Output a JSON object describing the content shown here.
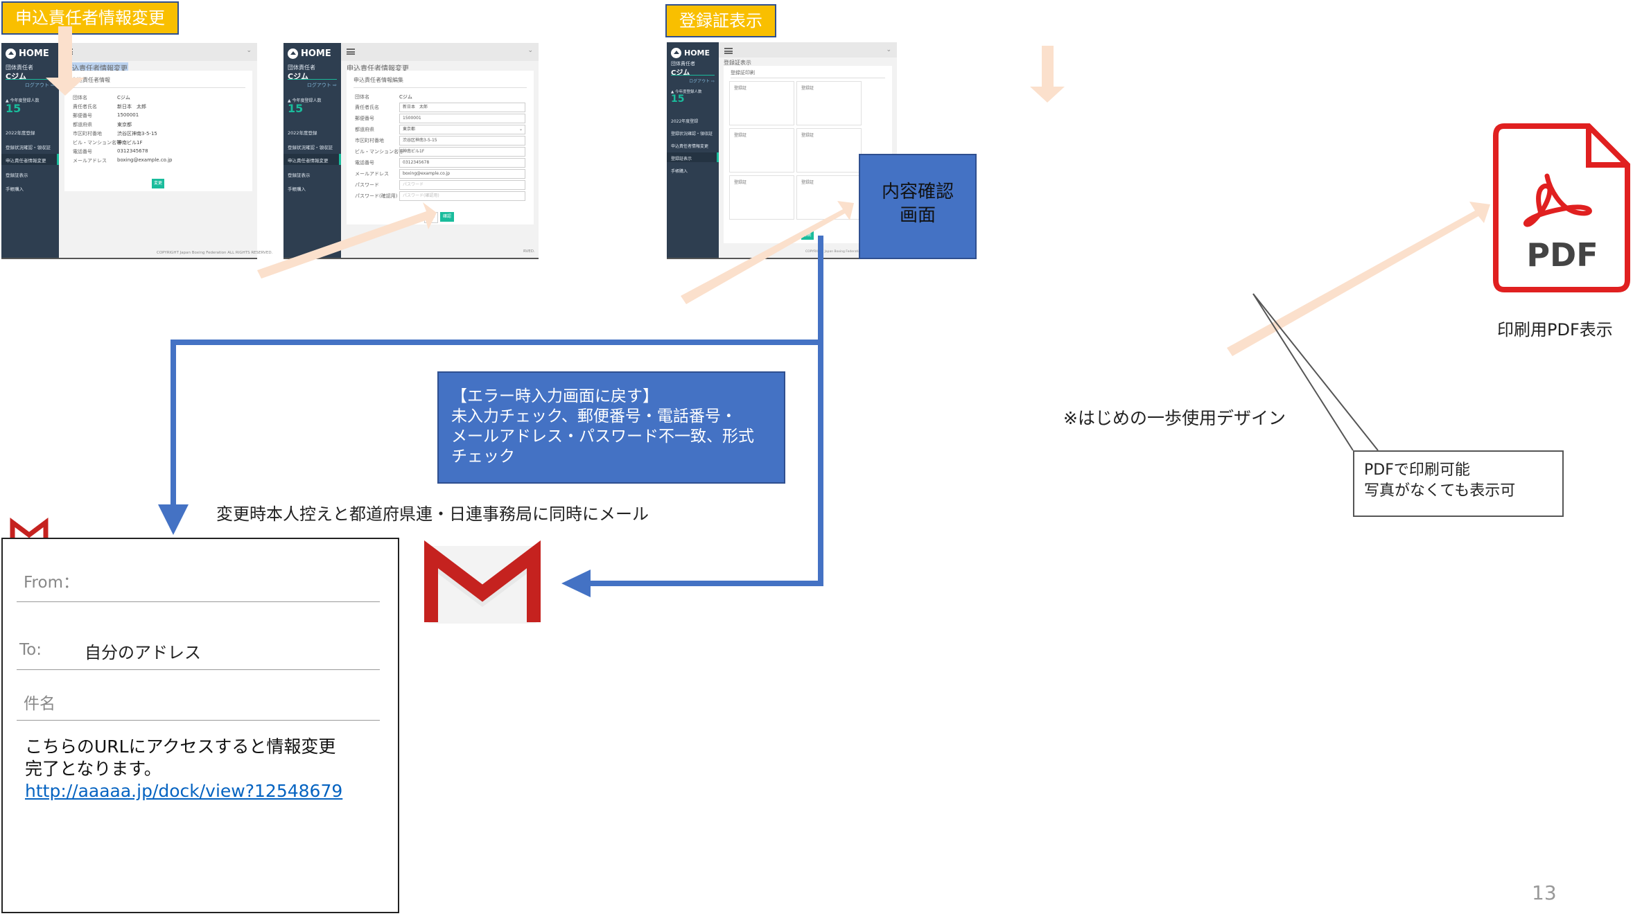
{
  "tags": {
    "tag1": "申込責任者情報変更",
    "tag2": "登録証表示"
  },
  "screen1": {
    "home": "HOME",
    "role": "団体責任者",
    "org": "Cジム",
    "logout": "ログアウト ⇨",
    "count_label": "▲ 今年度登録人数",
    "count": "15",
    "menu": [
      "2022年度登録",
      "登録状況確認・領収証",
      "申込責任者情報変更",
      "登録証表示",
      "手帳購入"
    ],
    "page_title": "申込責任者情報変更",
    "panel_title": "申込責任者情報",
    "labels": [
      "団体名",
      "責任者氏名",
      "郵便番号",
      "都道府県",
      "市区町村番地",
      "ビル・マンション名等",
      "電話番号",
      "メールアドレス"
    ],
    "values": [
      "Cジム",
      "新日本　太郎",
      "1500001",
      "東京都",
      "渋谷区神南3-5-15",
      "神南ビル1F",
      "0312345678",
      "boxing@example.co.jp"
    ],
    "button": "変更",
    "copyright": "COPYRIGHT Japan Boxing Federation ALL RIGHTS RESERVED."
  },
  "screen2": {
    "home": "HOME",
    "role": "団体責任者",
    "org": "Cジム",
    "logout": "ログアウト ⇨",
    "count_label": "▲ 今年度登録人数",
    "count": "15",
    "menu": [
      "2022年度登録",
      "登録状況確認・領収証",
      "申込責任者情報変更",
      "登録証表示",
      "手帳購入"
    ],
    "page_title": "申込責任者情報変更",
    "panel_title": "申込責任者情報編集",
    "org_label": "団体名",
    "org_value": "Cジム",
    "labels": [
      "責任者氏名",
      "郵便番号",
      "都道府県",
      "市区町村番地",
      "ビル・マンション名等",
      "電話番号",
      "メールアドレス",
      "パスワード",
      "パスワード(確認用)"
    ],
    "values": [
      "新日本　太郎",
      "1500001",
      "東京都",
      "渋谷区神南3-5-15",
      "神南ビル1F",
      "0312345678",
      "boxing@example.co.jp",
      "パスワード",
      "パスワード(確認用)"
    ],
    "back_button": "戻る",
    "confirm_button": "確認",
    "copyright_tail": "RVED."
  },
  "screen3": {
    "home": "HOME",
    "role": "団体責任者",
    "org": "Cジム",
    "logout": "ログアウト ⇨",
    "count_label": "▲ 今年度登録人数",
    "count": "15",
    "menu": [
      "2022年度登録",
      "登録状況確認・領収証",
      "申込責任者情報変更",
      "登録証表示",
      "手帳購入"
    ],
    "page_title": "登録証表示",
    "panel_title": "登録証印刷",
    "cards": [
      "登録証",
      "登録証",
      "登録証",
      "登録証",
      "登録証",
      "登録証"
    ],
    "button": "印刷",
    "copyright": "COPYRIGHT Japan Boxing Federation ALL RIGHTS RESERVED."
  },
  "confirm_box": {
    "line1": "内容確認",
    "line2": "画面"
  },
  "error_box": {
    "line1": "【エラー時入力画面に戻す】",
    "line2": "未入力チェック、郵便番号・電話番号・",
    "line3": "メールアドレス・パスワード不一致、形式",
    "line4": "チェック"
  },
  "mail_caption": "変更時本人控えと都道府県連・日連事務局に同時にメール",
  "email": {
    "from": "From：",
    "to_label": "To:",
    "to_value": "自分のアドレス",
    "subject": "件名",
    "body1": "こちらのURLにアクセスすると情報変更",
    "body2": "完了となります。",
    "link": "http://aaaaa.jp/dock/view?12548679"
  },
  "pdf": {
    "icon_text": "PDF",
    "caption": "印刷用PDF表示"
  },
  "design_note": "※はじめの一歩使用デザイン",
  "callout": {
    "line1": "PDFで印刷可能",
    "line2": "写真がなくても表示可"
  },
  "page_number": "13",
  "colors": {
    "tag": "#f9bf00",
    "box_blue": "#4472c4",
    "connector": "#4472c4",
    "arrow_peach": "#fbe0cc",
    "sidebar": "#2e3e50",
    "accent": "#1abc9c",
    "gmail_red": "#c5221f",
    "pdf_red": "#e02020"
  }
}
